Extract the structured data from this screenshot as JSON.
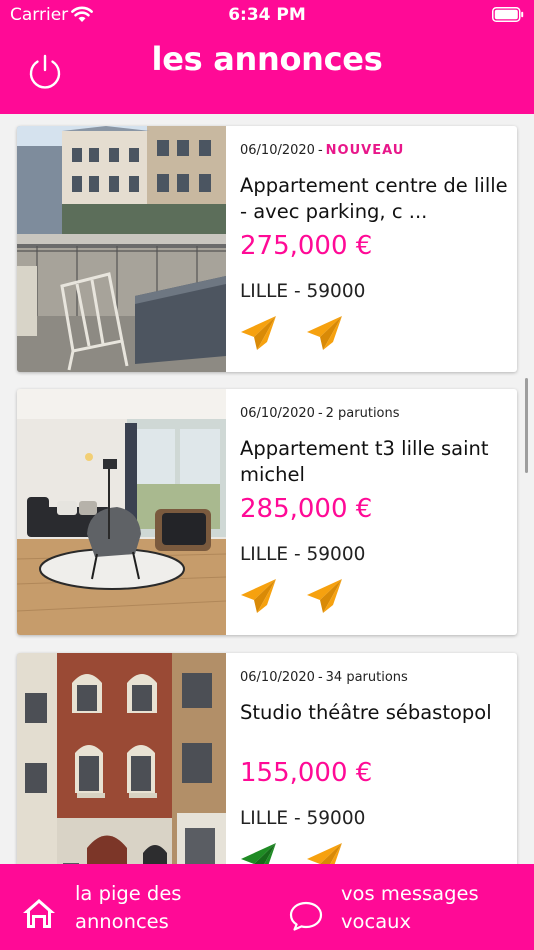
{
  "status_bar": {
    "carrier": "Carrier",
    "time": "6:34 PM"
  },
  "header": {
    "title": "les annonces",
    "power_icon": "power-icon"
  },
  "colors": {
    "brand": "#ff0a96",
    "badge": "#e8178a",
    "send_orange": "#f6a10f",
    "send_green": "#1f8b24"
  },
  "listings": [
    {
      "date": "06/10/2020",
      "separator": "-",
      "status": "NOUVEAU",
      "title": "Appartement centre de lille - avec parking, c ...",
      "price": "275,000 €",
      "location": "LILLE - 59000",
      "image": "balcony-photo",
      "actions": [
        {
          "icon": "send-icon",
          "color": "orange"
        },
        {
          "icon": "send-icon",
          "color": "orange"
        }
      ]
    },
    {
      "date": "06/10/2020",
      "separator": "-",
      "status": "2 parutions",
      "title": "Appartement t3 lille saint michel",
      "price": "285,000 €",
      "location": "LILLE - 59000",
      "image": "living-room-photo",
      "actions": [
        {
          "icon": "send-icon",
          "color": "orange"
        },
        {
          "icon": "send-icon",
          "color": "orange"
        }
      ]
    },
    {
      "date": "06/10/2020",
      "separator": "-",
      "status": "34 parutions",
      "title": "Studio théâtre sébastopol",
      "price": "155,000 €",
      "location": "LILLE - 59000",
      "image": "brick-facade-photo",
      "actions": [
        {
          "icon": "send-icon",
          "color": "green"
        },
        {
          "icon": "send-icon",
          "color": "orange"
        }
      ]
    }
  ],
  "bottom_nav": {
    "items": [
      {
        "label": "la pige des annonces",
        "icon": "home-icon"
      },
      {
        "label": "vos messages vocaux",
        "icon": "chat-bubble-icon"
      }
    ]
  }
}
